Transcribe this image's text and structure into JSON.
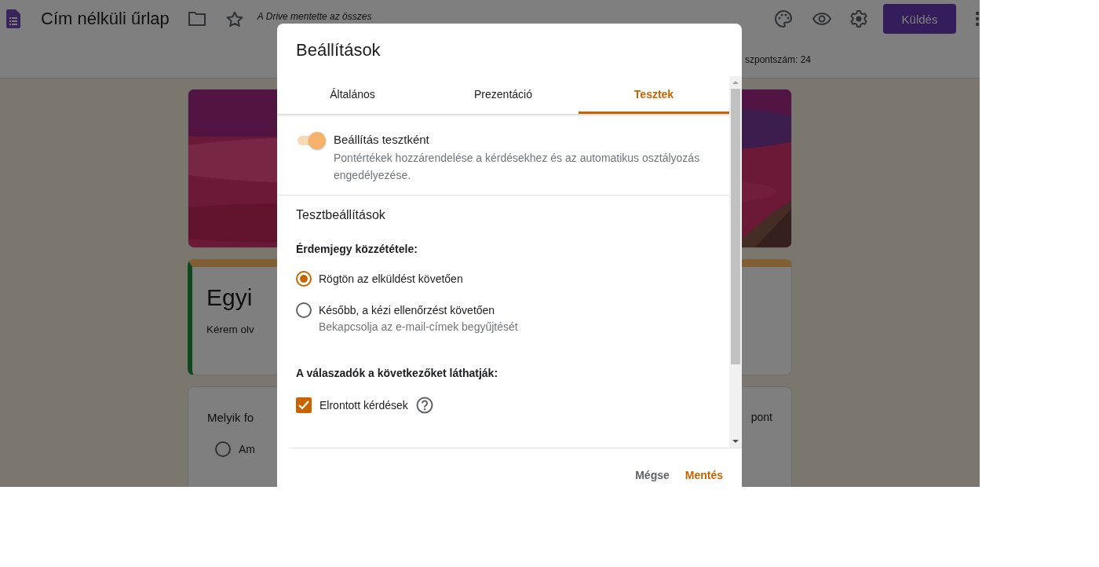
{
  "app_bar": {
    "title": "Cím nélküli űrlap",
    "save_status": "A Drive mentette az összes",
    "send_button": "Küldés"
  },
  "total_points": "szpontszám: 24",
  "form": {
    "title": "Egyi",
    "description": "Kérem olv",
    "question": {
      "text": "Melyik fo",
      "points": "pont",
      "options": [
        {
          "label": "Am",
          "selected": false
        }
      ]
    }
  },
  "dialog": {
    "title": "Beállítások",
    "tabs": [
      {
        "label": "Általános",
        "selected": false
      },
      {
        "label": "Prezentáció",
        "selected": false
      },
      {
        "label": "Tesztek",
        "selected": true
      }
    ],
    "quiz_toggle": {
      "label": "Beállítás tesztként",
      "description": "Pontértékek hozzárendelése a kérdésekhez és az automatikus osztályozás engedélyezése.",
      "on": true
    },
    "section_title": "Tesztbeállítások",
    "release": {
      "label": "Érdemjegy közzététele:",
      "options": [
        {
          "label": "Rögtön az elküldést követően",
          "selected": true
        },
        {
          "label": "Később, a kézi ellenőrzést követően",
          "hint": "Bekapcsolja az e-mail-címek begyűjtését",
          "selected": false
        }
      ]
    },
    "visibility": {
      "label": "A válaszadók a következőket láthatják:",
      "items": [
        {
          "label": "Elrontott kérdések",
          "checked": true,
          "help": true
        }
      ]
    },
    "buttons": [
      {
        "label": "Mégse",
        "kind": "cancel"
      },
      {
        "label": "Mentés",
        "kind": "primary"
      }
    ]
  }
}
